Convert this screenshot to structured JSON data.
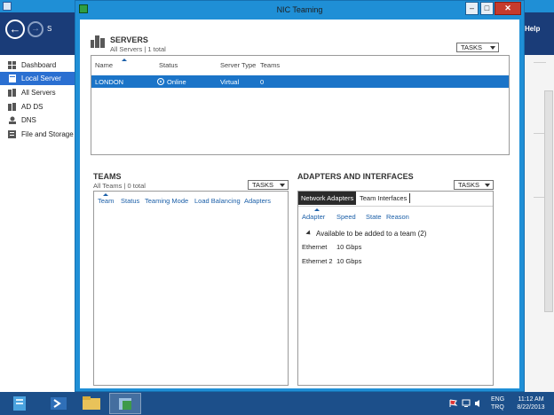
{
  "background": {
    "sidebar_items": [
      {
        "label": "Dashboard",
        "icon": "dashboard-icon"
      },
      {
        "label": "Local Server",
        "icon": "server-icon",
        "active": true
      },
      {
        "label": "All Servers",
        "icon": "servers-icon"
      },
      {
        "label": "AD DS",
        "icon": "adds-icon"
      },
      {
        "label": "DNS",
        "icon": "dns-icon"
      },
      {
        "label": "File and Storage",
        "icon": "storage-icon"
      }
    ],
    "header_partial_text": "S",
    "help_label": "Help"
  },
  "dialog": {
    "title": "NIC Teaming",
    "servers": {
      "title": "SERVERS",
      "subtitle": "All Servers | 1 total",
      "tasks_label": "TASKS",
      "columns": [
        "Name",
        "Status",
        "Server Type",
        "Teams"
      ],
      "rows": [
        {
          "name": "LONDON",
          "status": "Online",
          "server_type": "Virtual",
          "teams": "0"
        }
      ]
    },
    "teams": {
      "title": "TEAMS",
      "subtitle": "All Teams | 0 total",
      "tasks_label": "TASKS",
      "columns": [
        "Team",
        "Status",
        "Teaming Mode",
        "Load Balancing",
        "Adapters"
      ]
    },
    "adapters": {
      "title": "ADAPTERS AND INTERFACES",
      "tasks_label": "TASKS",
      "tabs": [
        "Network Adapters",
        "Team Interfaces"
      ],
      "columns": [
        "Adapter",
        "Speed",
        "State",
        "Reason"
      ],
      "group_label": "Available to be added to a team (2)",
      "rows": [
        {
          "adapter": "Ethernet",
          "speed": "10 Gbps"
        },
        {
          "adapter": "Ethernet 2",
          "speed": "10 Gbps"
        }
      ]
    }
  },
  "taskbar": {
    "language": "ENG",
    "layout": "TRQ",
    "time": "11:12 AM",
    "date": "8/22/2013"
  },
  "colors": {
    "accent": "#1f8fd6",
    "selection": "#1b74c8",
    "header": "#1a3c78",
    "taskbar": "#1c4f8a"
  }
}
